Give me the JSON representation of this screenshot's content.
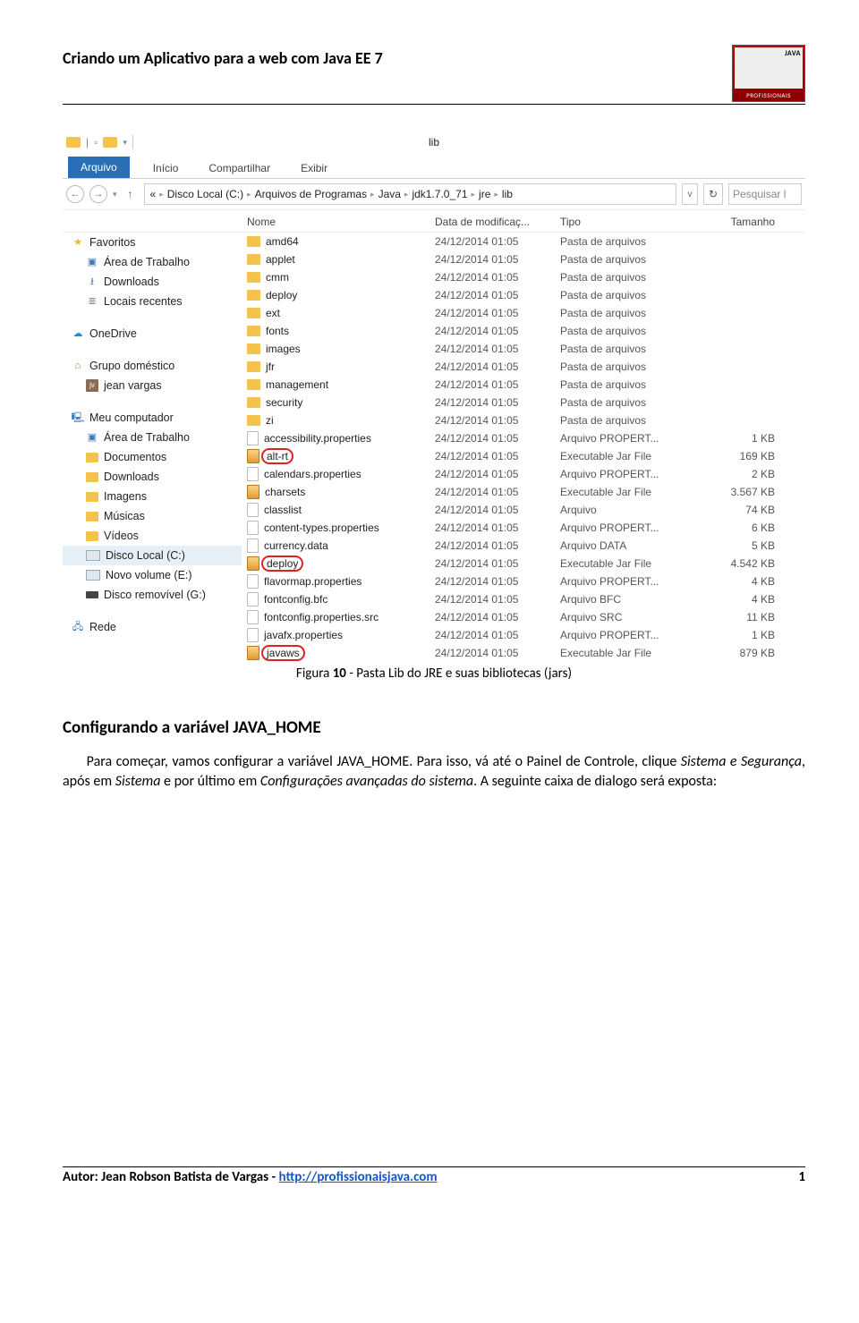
{
  "doc_header": "Criando um Aplicativo para a web com Java EE 7",
  "logo_caption": "PROFISSIONAIS",
  "window_title": "lib",
  "ribbon": {
    "file": "Arquivo",
    "home": "Início",
    "share": "Compartilhar",
    "view": "Exibir"
  },
  "breadcrumb": [
    "«",
    "Disco Local (C:)",
    "Arquivos de Programas",
    "Java",
    "jdk1.7.0_71",
    "jre",
    "lib"
  ],
  "nav": {
    "back": "←",
    "fwd": "→",
    "up": "↑",
    "dd": "v",
    "refresh": "↻"
  },
  "search_ph": "Pesquisar l",
  "columns": {
    "name": "Nome",
    "date": "Data de modificaç...",
    "type": "Tipo",
    "size": "Tamanho"
  },
  "sidebar": {
    "fav": "Favoritos",
    "fav_items": [
      "Área de Trabalho",
      "Downloads",
      "Locais recentes"
    ],
    "sky": "OneDrive",
    "home": "Grupo doméstico",
    "home_user": "jean vargas",
    "pc": "Meu computador",
    "pc_items": [
      "Área de Trabalho",
      "Documentos",
      "Downloads",
      "Imagens",
      "Músicas",
      "Vídeos",
      "Disco Local (C:)",
      "Novo volume (E:)",
      "Disco removível (G:)"
    ],
    "net": "Rede"
  },
  "rows": [
    {
      "n": "amd64",
      "d": "24/12/2014 01:05",
      "t": "Pasta de arquivos",
      "s": "",
      "i": "fold"
    },
    {
      "n": "applet",
      "d": "24/12/2014 01:05",
      "t": "Pasta de arquivos",
      "s": "",
      "i": "fold"
    },
    {
      "n": "cmm",
      "d": "24/12/2014 01:05",
      "t": "Pasta de arquivos",
      "s": "",
      "i": "fold"
    },
    {
      "n": "deploy",
      "d": "24/12/2014 01:05",
      "t": "Pasta de arquivos",
      "s": "",
      "i": "fold"
    },
    {
      "n": "ext",
      "d": "24/12/2014 01:05",
      "t": "Pasta de arquivos",
      "s": "",
      "i": "fold"
    },
    {
      "n": "fonts",
      "d": "24/12/2014 01:05",
      "t": "Pasta de arquivos",
      "s": "",
      "i": "fold"
    },
    {
      "n": "images",
      "d": "24/12/2014 01:05",
      "t": "Pasta de arquivos",
      "s": "",
      "i": "fold"
    },
    {
      "n": "jfr",
      "d": "24/12/2014 01:05",
      "t": "Pasta de arquivos",
      "s": "",
      "i": "fold"
    },
    {
      "n": "management",
      "d": "24/12/2014 01:05",
      "t": "Pasta de arquivos",
      "s": "",
      "i": "fold"
    },
    {
      "n": "security",
      "d": "24/12/2014 01:05",
      "t": "Pasta de arquivos",
      "s": "",
      "i": "fold"
    },
    {
      "n": "zi",
      "d": "24/12/2014 01:05",
      "t": "Pasta de arquivos",
      "s": "",
      "i": "fold"
    },
    {
      "n": "accessibility.properties",
      "d": "24/12/2014 01:05",
      "t": "Arquivo PROPERT...",
      "s": "1 KB",
      "i": "doc"
    },
    {
      "n": "alt-rt",
      "d": "24/12/2014 01:05",
      "t": "Executable Jar File",
      "s": "169 KB",
      "i": "jar",
      "mark": true
    },
    {
      "n": "calendars.properties",
      "d": "24/12/2014 01:05",
      "t": "Arquivo PROPERT...",
      "s": "2 KB",
      "i": "doc"
    },
    {
      "n": "charsets",
      "d": "24/12/2014 01:05",
      "t": "Executable Jar File",
      "s": "3.567 KB",
      "i": "jar"
    },
    {
      "n": "classlist",
      "d": "24/12/2014 01:05",
      "t": "Arquivo",
      "s": "74 KB",
      "i": "doc"
    },
    {
      "n": "content-types.properties",
      "d": "24/12/2014 01:05",
      "t": "Arquivo PROPERT...",
      "s": "6 KB",
      "i": "doc"
    },
    {
      "n": "currency.data",
      "d": "24/12/2014 01:05",
      "t": "Arquivo DATA",
      "s": "5 KB",
      "i": "doc"
    },
    {
      "n": "deploy",
      "d": "24/12/2014 01:05",
      "t": "Executable Jar File",
      "s": "4.542 KB",
      "i": "jar",
      "mark": true
    },
    {
      "n": "flavormap.properties",
      "d": "24/12/2014 01:05",
      "t": "Arquivo PROPERT...",
      "s": "4 KB",
      "i": "doc"
    },
    {
      "n": "fontconfig.bfc",
      "d": "24/12/2014 01:05",
      "t": "Arquivo BFC",
      "s": "4 KB",
      "i": "doc"
    },
    {
      "n": "fontconfig.properties.src",
      "d": "24/12/2014 01:05",
      "t": "Arquivo SRC",
      "s": "11 KB",
      "i": "doc"
    },
    {
      "n": "javafx.properties",
      "d": "24/12/2014 01:05",
      "t": "Arquivo PROPERT...",
      "s": "1 KB",
      "i": "doc"
    },
    {
      "n": "javaws",
      "d": "24/12/2014 01:05",
      "t": "Executable Jar File",
      "s": "879 KB",
      "i": "jar",
      "mark": true
    }
  ],
  "caption_prefix": "Figura ",
  "caption_num": "10",
  "caption_rest": " - Pasta Lib do JRE e suas bibliotecas (jars)",
  "section": "Configurando a variável JAVA_HOME",
  "para_1": "Para começar, vamos configurar a variável JAVA_HOME. Para isso, vá até o Painel de Controle, clique ",
  "para_i1": "Sistema e Segurança",
  "para_2": ", após em ",
  "para_i2": "Sistema",
  "para_3": " e por último em ",
  "para_i3": "Configurações avançadas do sistema",
  "para_4": ". A seguinte caixa de dialogo será exposta:",
  "footer_author": "Autor: Jean Robson Batista de Vargas - ",
  "footer_link": "http://profissionaisjava.com",
  "footer_page": "1"
}
